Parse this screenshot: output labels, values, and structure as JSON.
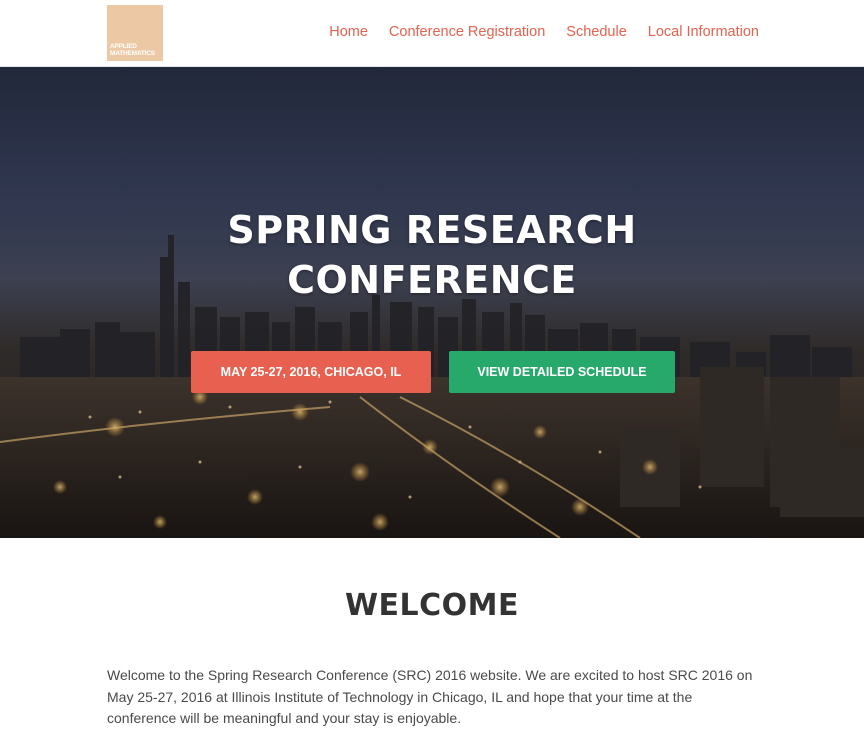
{
  "header": {
    "logo_text": "APPLIED MATHEMATICS",
    "nav": [
      {
        "label": "Home"
      },
      {
        "label": "Conference Registration"
      },
      {
        "label": "Schedule"
      },
      {
        "label": "Local Information"
      }
    ]
  },
  "hero": {
    "title_line1": "SPRING RESEARCH",
    "title_line2": "CONFERENCE",
    "date_button": "MAY 25-27, 2016, CHICAGO, IL",
    "schedule_button": "VIEW DETAILED SCHEDULE"
  },
  "welcome": {
    "heading": "WELCOME",
    "body": "Welcome to the Spring Research Conference (SRC) 2016 website. We are excited to host SRC 2016 on May 25-27, 2016 at Illinois Institute of Technology in Chicago, IL and hope that your time at the conference will be meaningful and your stay is enjoyable."
  },
  "colors": {
    "accent": "#e8604f",
    "green": "#27a96c",
    "logo_bg": "#ecc9a4"
  }
}
